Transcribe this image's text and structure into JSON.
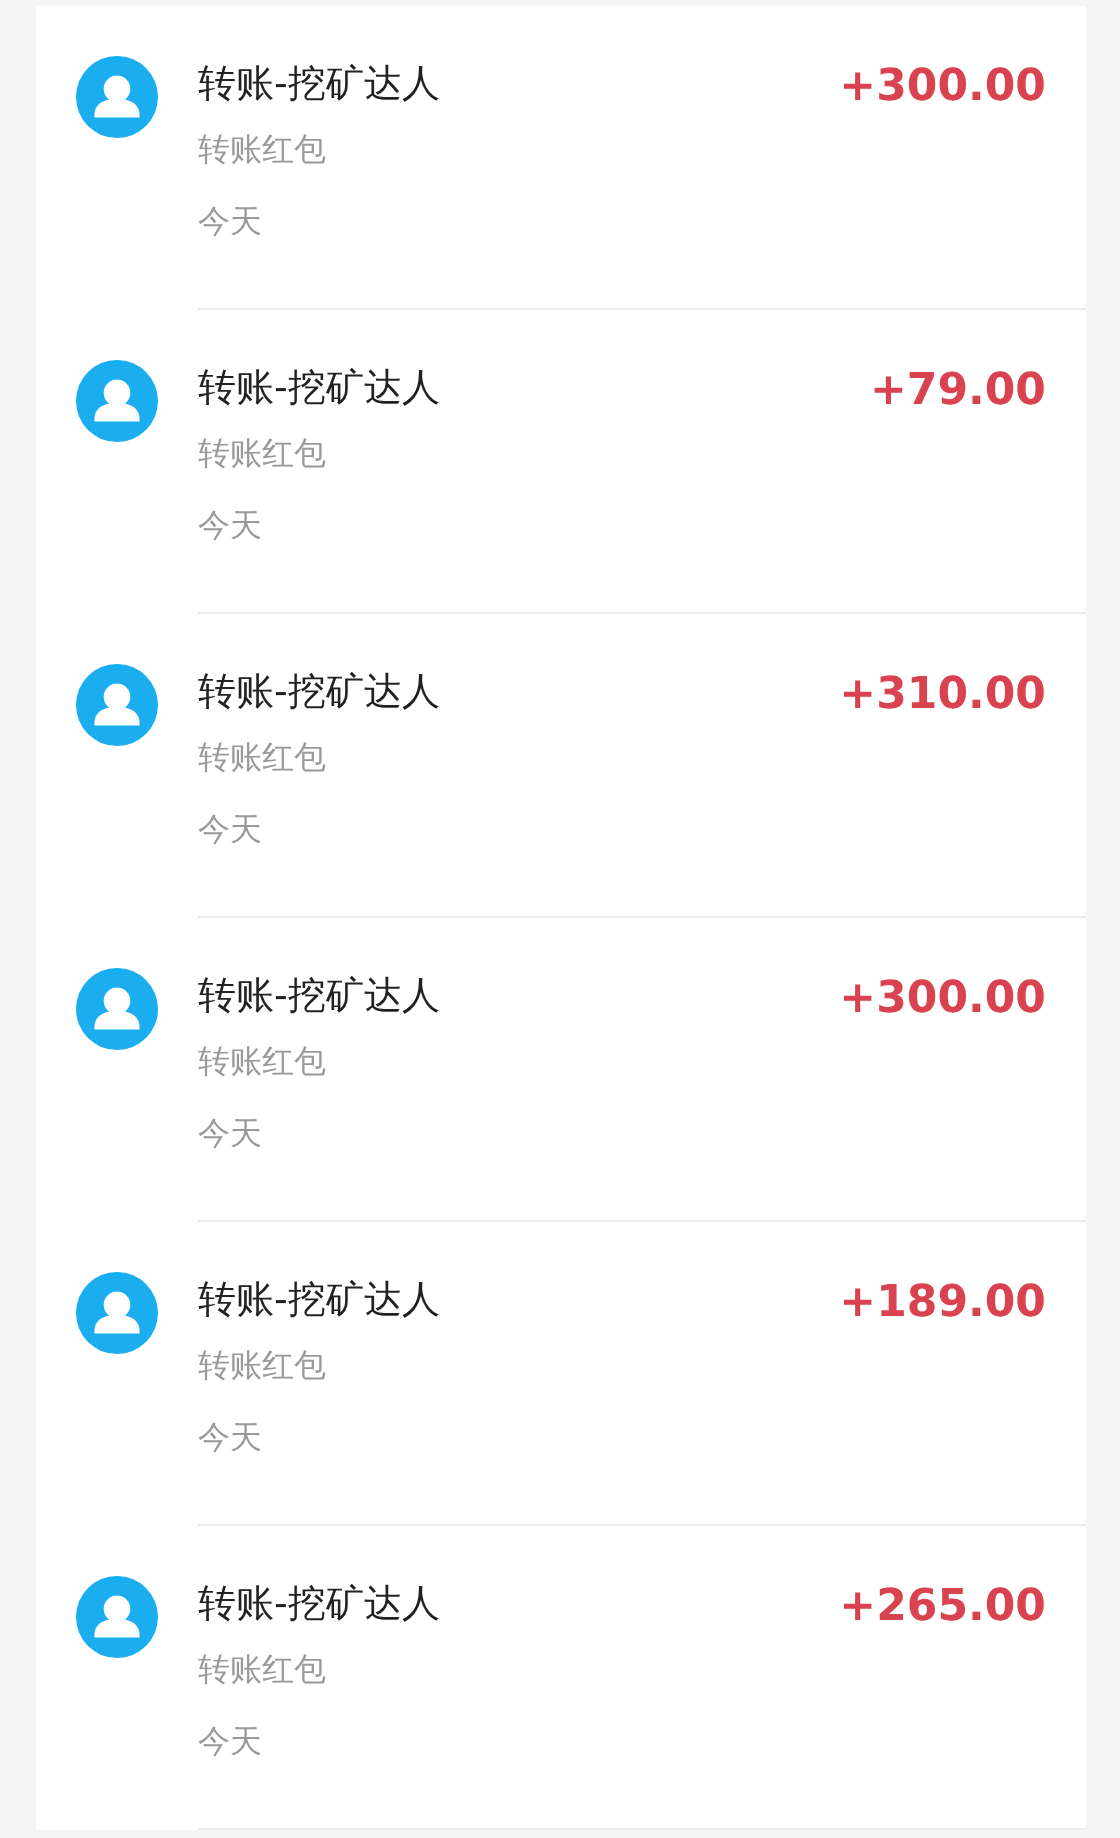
{
  "transactions": [
    {
      "title": "转账-挖矿达人",
      "subtitle": "转账红包",
      "date": "今天",
      "amount": "+300.00"
    },
    {
      "title": "转账-挖矿达人",
      "subtitle": "转账红包",
      "date": "今天",
      "amount": "+79.00"
    },
    {
      "title": "转账-挖矿达人",
      "subtitle": "转账红包",
      "date": "今天",
      "amount": "+310.00"
    },
    {
      "title": "转账-挖矿达人",
      "subtitle": "转账红包",
      "date": "今天",
      "amount": "+300.00"
    },
    {
      "title": "转账-挖矿达人",
      "subtitle": "转账红包",
      "date": "今天",
      "amount": "+189.00"
    },
    {
      "title": "转账-挖矿达人",
      "subtitle": "转账红包",
      "date": "今天",
      "amount": "+265.00"
    }
  ]
}
